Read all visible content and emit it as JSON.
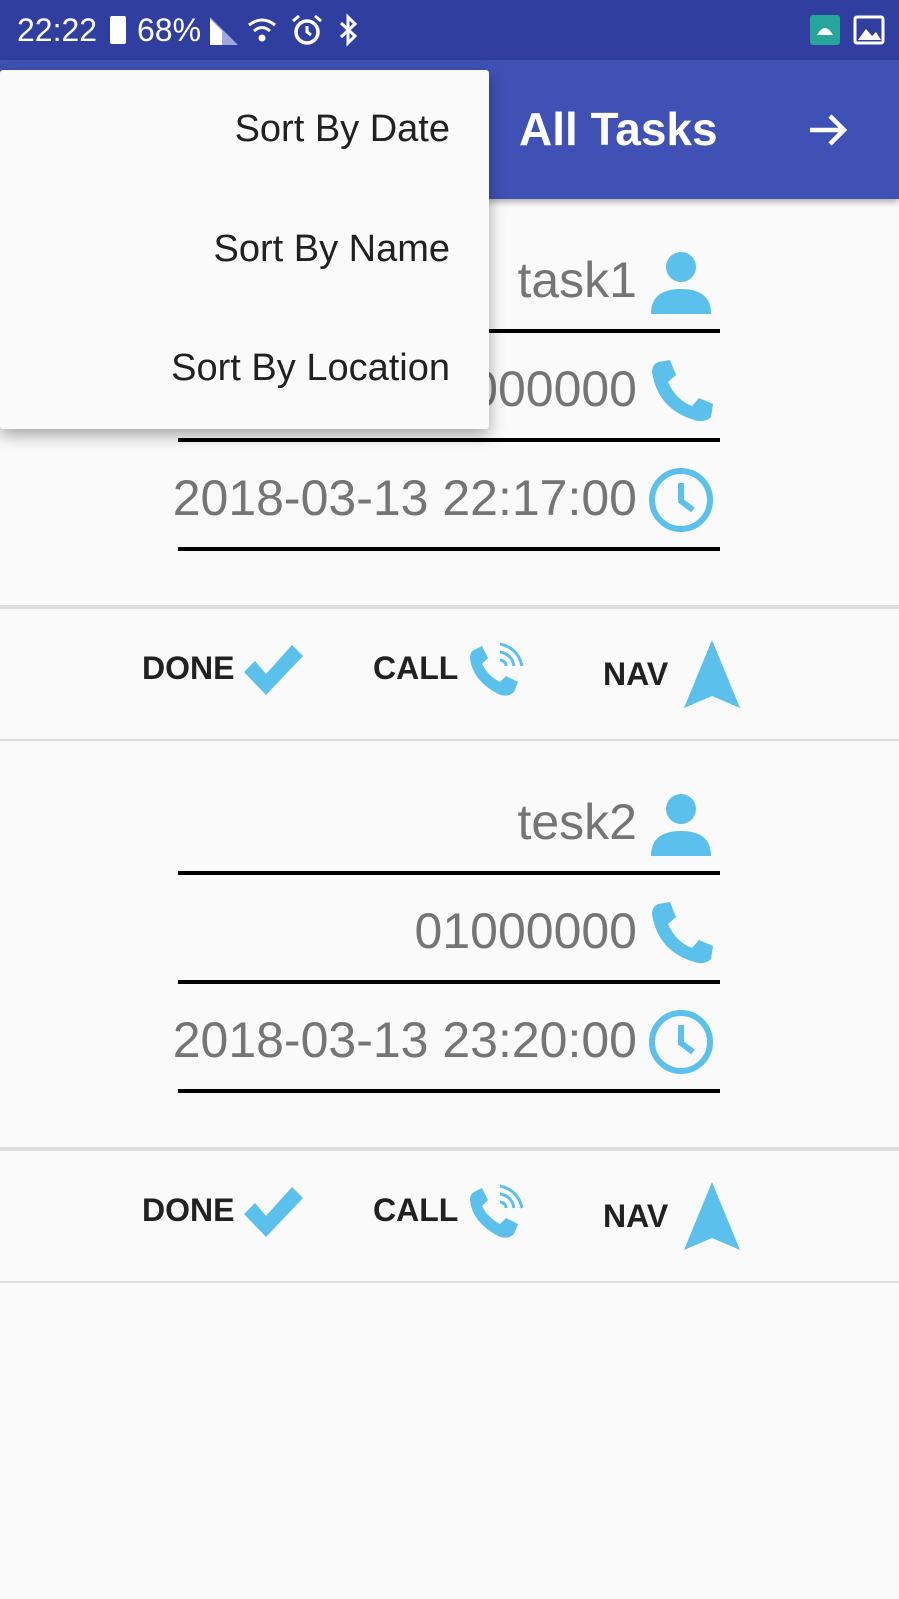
{
  "status_bar": {
    "time": "22:22",
    "battery": "68%"
  },
  "app_bar": {
    "title": "All Tasks"
  },
  "menu": {
    "items": [
      "Sort By Date",
      "Sort By Name",
      "Sort By Location"
    ]
  },
  "tasks": [
    {
      "name": "task1",
      "phone": "01000000",
      "datetime": "2018-03-13 22:17:00"
    },
    {
      "name": "tesk2",
      "phone": "01000000",
      "datetime": "2018-03-13 23:20:00"
    }
  ],
  "actions": {
    "done": "DONE",
    "call": "CALL",
    "nav": "NAV"
  },
  "colors": {
    "status_bar": "#303f9f",
    "app_bar": "#3f51b5",
    "icon_accent": "#5bc0eb",
    "field_text": "#757575"
  }
}
